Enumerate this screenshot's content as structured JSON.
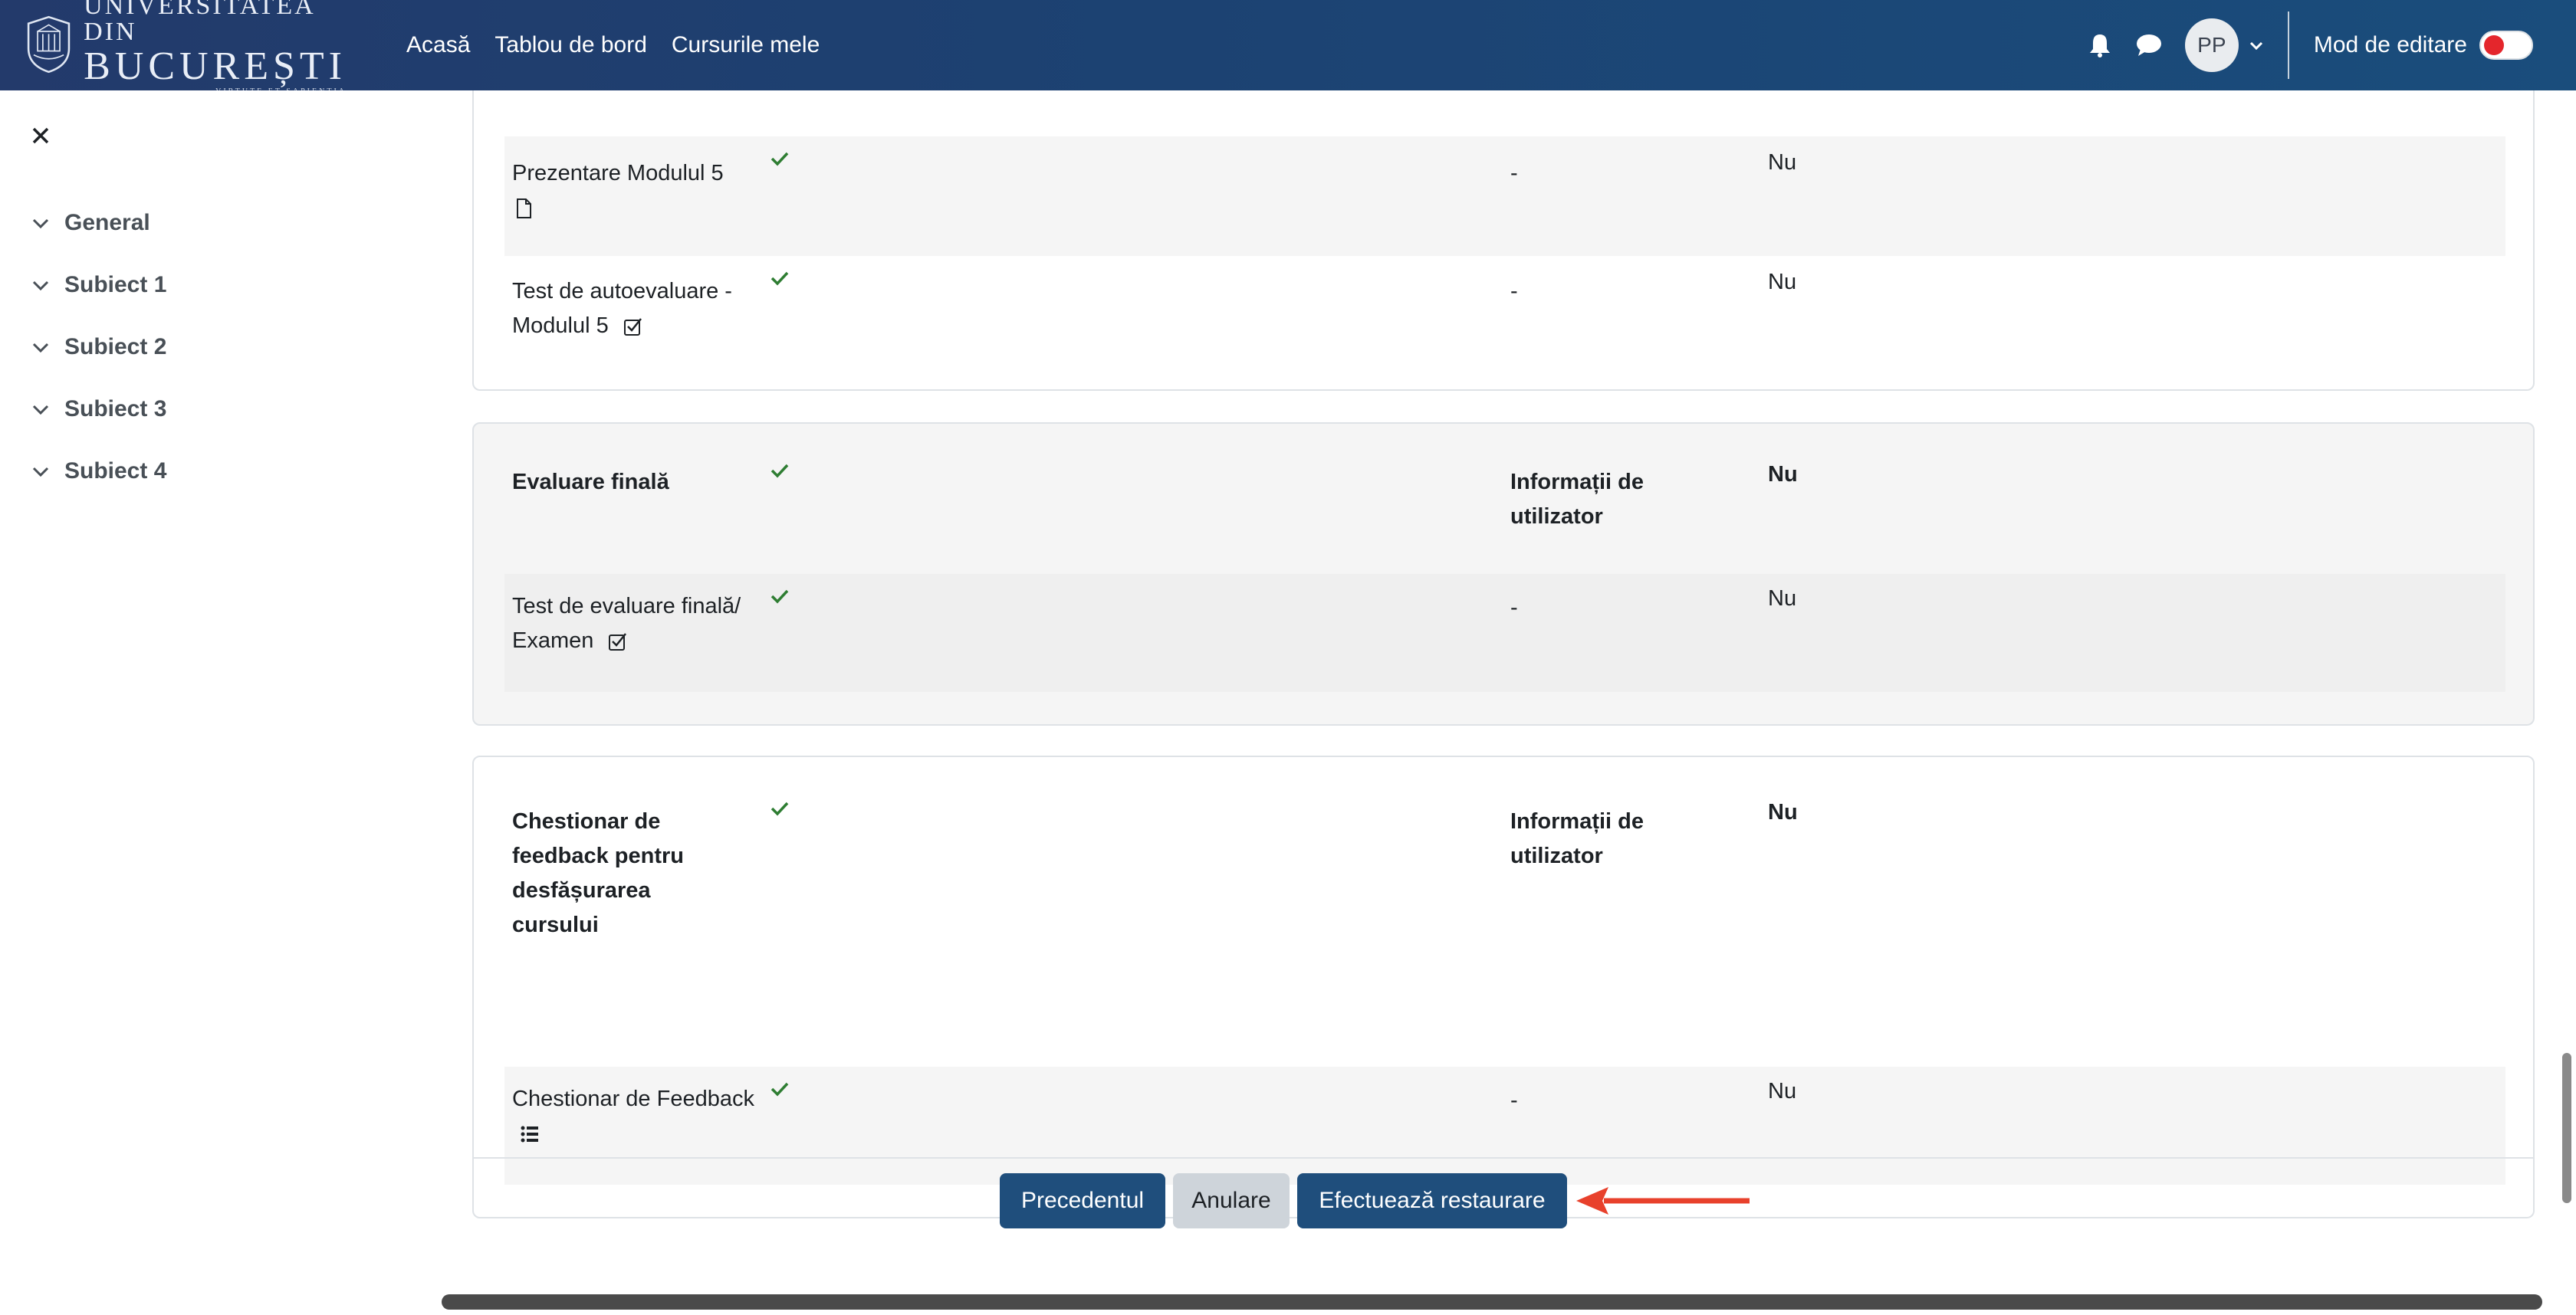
{
  "brand": {
    "line1": "UNIVERSITATEA DIN",
    "line2": "BUCUREȘTI",
    "line3": "VIRTUTE ET SAPIENTIA"
  },
  "nav": {
    "links": [
      "Acasă",
      "Tablou de bord",
      "Cursurile mele"
    ],
    "avatar_initials": "PP",
    "edit_mode_label": "Mod de editare",
    "edit_mode_on": false
  },
  "sidebar": {
    "items": [
      {
        "label": "General"
      },
      {
        "label": "Subiect 1"
      },
      {
        "label": "Subiect 2"
      },
      {
        "label": "Subiect 3"
      },
      {
        "label": "Subiect 4"
      }
    ]
  },
  "sections": {
    "module5": {
      "rows": [
        {
          "name": "Prezentare Modulul 5",
          "icon": "file-icon",
          "included": true,
          "info": "-",
          "overwrite": "Nu"
        },
        {
          "name": "Test de autoevaluare - Modulul 5",
          "icon": "quiz-icon",
          "included": true,
          "info": "-",
          "overwrite": "Nu"
        }
      ]
    },
    "final": {
      "header": {
        "name": "Evaluare finală",
        "included": true,
        "info": "Informații de utilizator",
        "overwrite": "Nu"
      },
      "rows": [
        {
          "name": "Test de evaluare finală/ Examen",
          "icon": "quiz-icon",
          "included": true,
          "info": "-",
          "overwrite": "Nu"
        }
      ]
    },
    "feedback": {
      "header": {
        "name": "Chestionar de feedback pentru desfășurarea cursului",
        "included": true,
        "info": "Informații de utilizator",
        "overwrite": "Nu"
      },
      "rows": [
        {
          "name": "Chestionar de Feedback",
          "icon": "feedback-icon",
          "included": true,
          "info": "-",
          "overwrite": "Nu"
        }
      ]
    }
  },
  "actions": {
    "previous": "Precedentul",
    "cancel": "Anulare",
    "restore": "Efectuează restaurare"
  },
  "colors": {
    "navbar": "#1c4272",
    "primary_button": "#1f4e7c",
    "check": "#2e7d32",
    "annotation_arrow": "#e8412c"
  }
}
